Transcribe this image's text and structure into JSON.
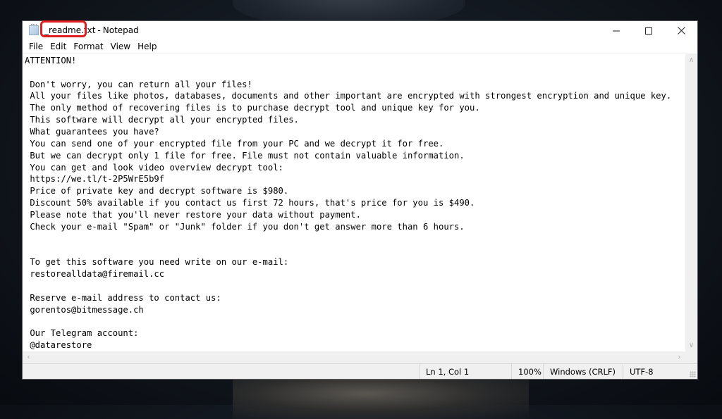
{
  "window": {
    "file_name": "_readme.txt",
    "separator": "-",
    "app_name": "Notepad",
    "controls": {
      "minimize": "minimize-icon",
      "maximize": "maximize-icon",
      "close": "close-icon"
    }
  },
  "menu": [
    "File",
    "Edit",
    "Format",
    "View",
    "Help"
  ],
  "document": {
    "lines": [
      "ATTENTION!",
      "",
      " Don't worry, you can return all your files!",
      " All your files like photos, databases, documents and other important are encrypted with strongest encryption and unique key.",
      " The only method of recovering files is to purchase decrypt tool and unique key for you.",
      " This software will decrypt all your encrypted files.",
      " What guarantees you have?",
      " You can send one of your encrypted file from your PC and we decrypt it for free.",
      " But we can decrypt only 1 file for free. File must not contain valuable information.",
      " You can get and look video overview decrypt tool:",
      " https://we.tl/t-2P5WrE5b9f",
      " Price of private key and decrypt software is $980.",
      " Discount 50% available if you contact us first 72 hours, that's price for you is $490.",
      " Please note that you'll never restore your data without payment.",
      " Check your e-mail \"Spam\" or \"Junk\" folder if you don't get answer more than 6 hours.",
      "",
      "",
      " To get this software you need write on our e-mail:",
      " restorealldata@firemail.cc",
      "",
      " Reserve e-mail address to contact us:",
      " gorentos@bitmessage.ch",
      "",
      " Our Telegram account:",
      " @datarestore"
    ]
  },
  "statusbar": {
    "position": "Ln 1, Col 1",
    "zoom": "100%",
    "line_ending": "Windows (CRLF)",
    "encoding": "UTF-8"
  },
  "annotation": {
    "highlight_color": "#e01e1e",
    "highlight_target": "_readme.txt"
  }
}
